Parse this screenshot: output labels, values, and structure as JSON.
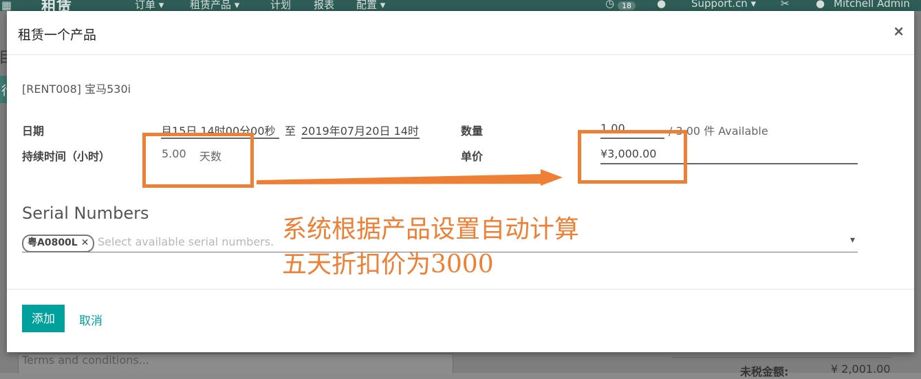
{
  "background": {
    "brand": "租赁",
    "menus": [
      "订单 ▾",
      "租赁产品 ▾",
      "计划",
      "报表",
      "配置 ▾"
    ],
    "badge_count": "18",
    "company": "Support.cn ▾",
    "user": "Mitchell Admin",
    "page_letter": "目",
    "strip_letter": "行",
    "terms_placeholder": "Terms and conditions...",
    "total_label": "未税金额:",
    "total_value": "¥ 2,001.00"
  },
  "modal": {
    "title": "租赁一个产品",
    "close_symbol": "×",
    "product": "[RENT008] 宝马530i",
    "fields": {
      "date_label": "日期",
      "date_from": "月15日 14时00分00秒",
      "date_sep": "至",
      "date_to": "2019年07月20日 14时",
      "duration_label": "持续时间（小时）",
      "duration_value": "5.00",
      "duration_unit": "天数",
      "qty_label": "数量",
      "qty_value": "1.00",
      "qty_available": "/ 3.00 件 Available",
      "price_label": "单价",
      "price_value": "¥3,000.00"
    },
    "serial": {
      "title": "Serial Numbers",
      "tag": "粤A0800L",
      "tag_remove": "✕",
      "placeholder": "Select available serial numbers.",
      "caret": "▾"
    },
    "buttons": {
      "add": "添加",
      "cancel": "取消"
    }
  },
  "annotation": {
    "line1": "系统根据产品设置自动计算",
    "line2": "五天折扣价为3000",
    "color": "#ee7f34"
  },
  "colors": {
    "primary": "#00a09d",
    "topbar": "#2d5d56",
    "annotation": "#ee7f34"
  }
}
